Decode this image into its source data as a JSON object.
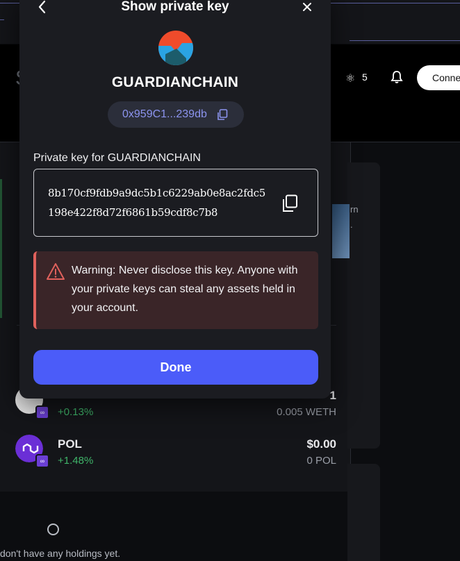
{
  "background": {
    "header": {
      "title_partial": "S",
      "fox_count": "5",
      "connect_label": "Conne"
    },
    "promo": {
      "line1": "rn",
      "line2": "."
    },
    "assets": [
      {
        "name": "",
        "change": "+0.13%",
        "value": "1",
        "amount": "0.005 WETH",
        "logo_color": "#ffffff"
      },
      {
        "name": "POL",
        "change": "+1.48%",
        "value": "$0.00",
        "amount": "0 POL",
        "logo_color": "#6b2fd6"
      }
    ],
    "empty_text": "don't have any holdings yet."
  },
  "modal": {
    "title": "Show private key",
    "account_name": "GUARDIANCHAIN",
    "address_short": "0x959C1...239db",
    "pk_label": "Private key for GUARDIANCHAIN",
    "private_key": "8b170cf9fdb9a9dc5b1c6229ab0e8ac2fdc5198e422f8d72f6861b59cdf8c7b8",
    "warning": "Warning: Never disclose this key. Anyone with your private keys can steal any assets held in your account.",
    "done_label": "Done"
  },
  "colors": {
    "accent": "#4b5cf9",
    "address_text": "#8c94ef",
    "warning_bg": "#3a2528",
    "warning_border": "#e0615c",
    "positive": "#3fb469"
  },
  "icons": [
    "back-arrow-icon",
    "close-icon",
    "copy-icon",
    "warning-triangle-icon",
    "bell-icon",
    "fox-icon",
    "chain-link-icon"
  ]
}
